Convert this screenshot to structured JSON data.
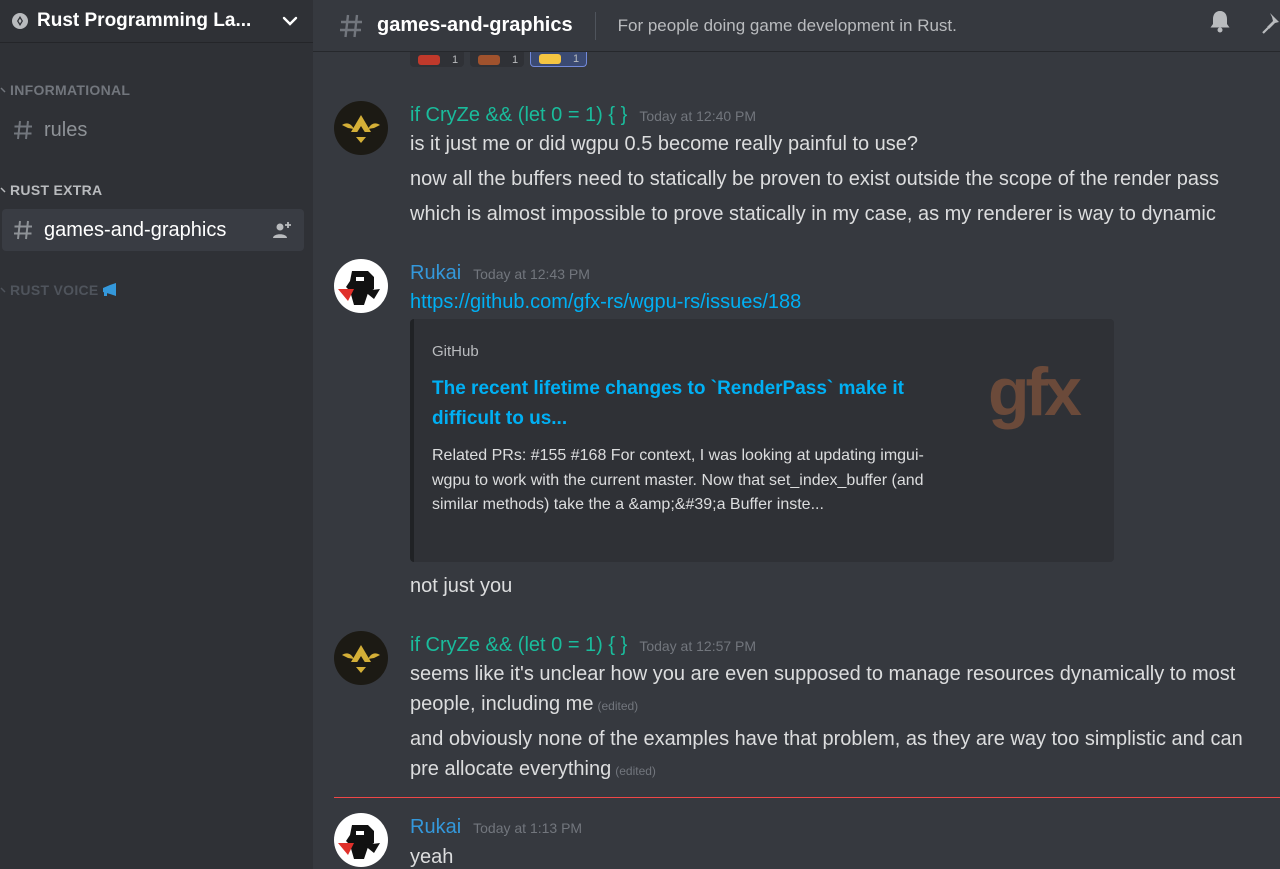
{
  "server": {
    "name": "Rust Programming La..."
  },
  "sidebar": {
    "categories": [
      {
        "label": "INFORMATIONAL"
      },
      {
        "label": "RUST EXTRA"
      },
      {
        "label": "RUST VOICE"
      }
    ],
    "channels": [
      {
        "name": "rules"
      },
      {
        "name": "games-and-graphics"
      }
    ]
  },
  "header": {
    "channel_name": "games-and-graphics",
    "topic": "For people doing game development in Rust."
  },
  "reactions": [
    {
      "count": "1"
    },
    {
      "count": "1"
    },
    {
      "count": "1"
    }
  ],
  "messages": [
    {
      "author": "if CryZe && (let 0 = 1) { }",
      "time": "Today at 12:40 PM",
      "lines": [
        "is it just me or did wgpu 0.5 become really painful to use?",
        "now all the buffers need to statically be proven to exist outside the scope of the render pass",
        "which is almost impossible to prove statically in my case, as my renderer is way to dynamic"
      ]
    },
    {
      "author": "Rukai",
      "time": "Today at 12:43 PM",
      "link": "https://github.com/gfx-rs/wgpu-rs/issues/188",
      "embed": {
        "provider": "GitHub",
        "title": "The recent lifetime changes to `RenderPass` make it difficult to us...",
        "description": "Related PRs: #155 #168 For context, I was looking at updating imgui-wgpu to work with the current master. Now that set_index_buffer (and similar methods) take the a &amp;&#39;a Buffer inste...",
        "thumbnail_text": "gfx"
      },
      "lines": [
        "not just you"
      ]
    },
    {
      "author": "if CryZe && (let 0 = 1) { }",
      "time": "Today at 12:57 PM",
      "lines": [
        "seems like it's unclear how you are even supposed to manage resources dynamically to most people, including me",
        "and obviously none of the examples have that problem, as they are way too simplistic and can pre allocate everything"
      ],
      "edited_label": "(edited)"
    },
    {
      "author": "Rukai",
      "time": "Today at 1:13 PM",
      "lines": [
        "yeah"
      ]
    }
  ],
  "colors": {
    "cryze_name": "#1abc9c",
    "rukai_name": "#3498db",
    "link": "#00b0f4",
    "new_messages_divider": "#f04747"
  }
}
